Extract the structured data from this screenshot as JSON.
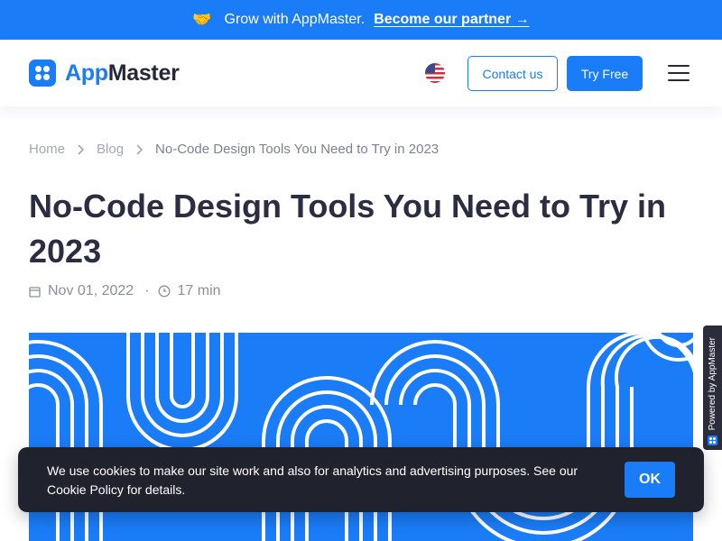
{
  "promo": {
    "text": "Grow with AppMaster.",
    "link": "Become our partner",
    "arrow": "→",
    "icon": "handshake-icon"
  },
  "header": {
    "logo_app": "App",
    "logo_master": "Master",
    "language": "en-US",
    "contact_label": "Contact us",
    "try_label": "Try Free"
  },
  "breadcrumb": {
    "home": "Home",
    "blog": "Blog",
    "current": "No-Code Design Tools You Need to Try in 2023"
  },
  "article": {
    "title": "No-Code Design Tools You Need to Try in 2023",
    "date": "Nov 01, 2022",
    "read_time": "17 min"
  },
  "powered_by": "Powered by AppMaster",
  "cookie": {
    "message": "We use cookies to make our site work and also for analytics and advertising purposes. See our Cookie Policy for details.",
    "ok_label": "OK"
  },
  "colors": {
    "brand": "#1a7cf7",
    "dark": "#2b2d42",
    "cookie_bg": "#20232e"
  }
}
